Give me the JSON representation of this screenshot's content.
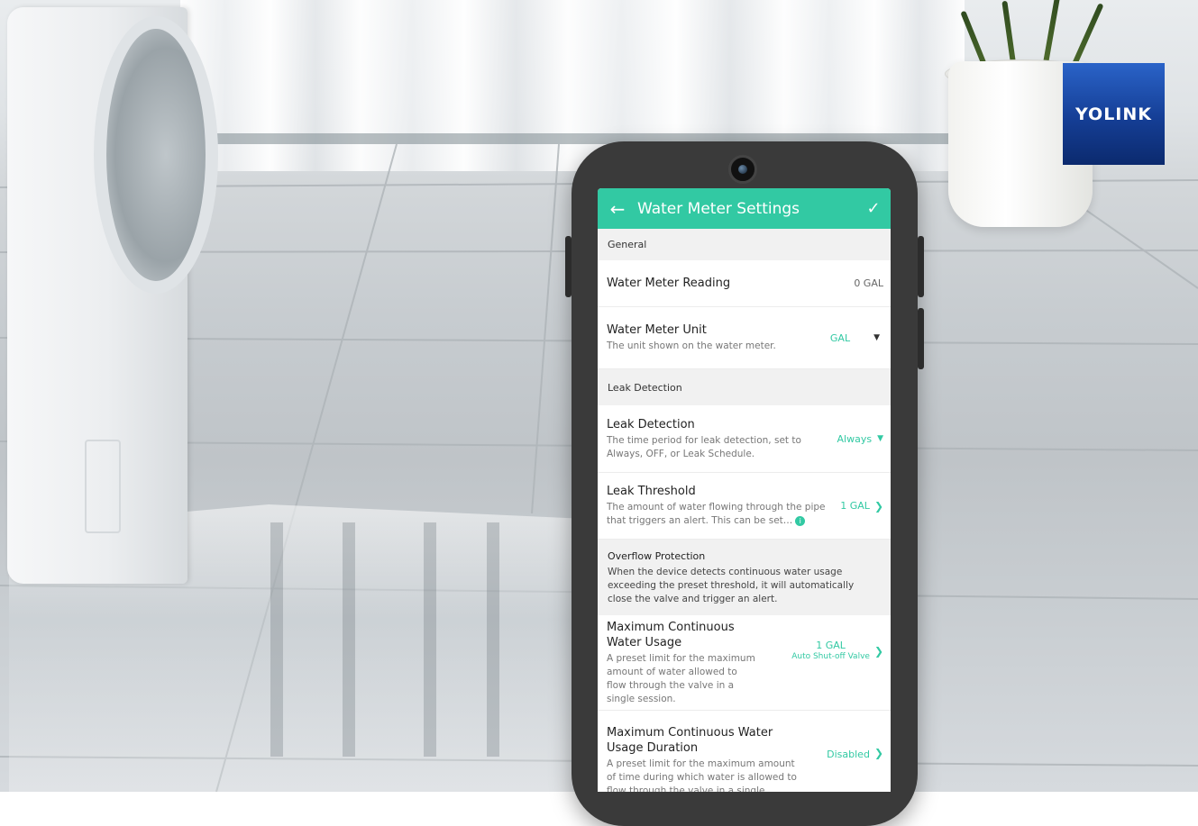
{
  "brand": {
    "logo_text": "YOLINK",
    "logo_color": "#1a4aa8"
  },
  "app": {
    "accent": "#32c9a3",
    "header": {
      "back_icon": "arrow-left-icon",
      "title": "Water Meter Settings",
      "confirm_icon": "check-icon"
    },
    "sections": {
      "general": "General",
      "leak_detection": "Leak Detection"
    },
    "general": {
      "reading": {
        "label": "Water Meter Reading",
        "value": "0 GAL"
      },
      "unit": {
        "label": "Water Meter Unit",
        "description": "The unit shown on the water meter.",
        "value": "GAL"
      }
    },
    "leak": {
      "detection": {
        "label": "Leak Detection",
        "description": "The time period for leak detection, set to Always, OFF, or Leak Schedule.",
        "value": "Always"
      },
      "threshold": {
        "label": "Leak Threshold",
        "description": "The amount of water flowing through the pipe that triggers an alert. This can be set…",
        "value": "1 GAL"
      }
    },
    "overflow": {
      "title": "Overflow Protection",
      "description": "When the device detects continuous water usage exceeding the preset threshold, it will automatically close the valve and trigger an alert."
    },
    "max_usage": {
      "label": "Maximum Continuous Water Usage",
      "description": "A preset limit for the maximum amount of water allowed to flow through the valve in a single session.",
      "value": "1 GAL",
      "subvalue": "Auto Shut-off Valve"
    },
    "max_duration": {
      "label": "Maximum Continuous Water Usage Duration",
      "description": "A preset limit for the maximum amount of time during which water is allowed to flow through the valve in a single session.",
      "value": "Disabled"
    }
  }
}
